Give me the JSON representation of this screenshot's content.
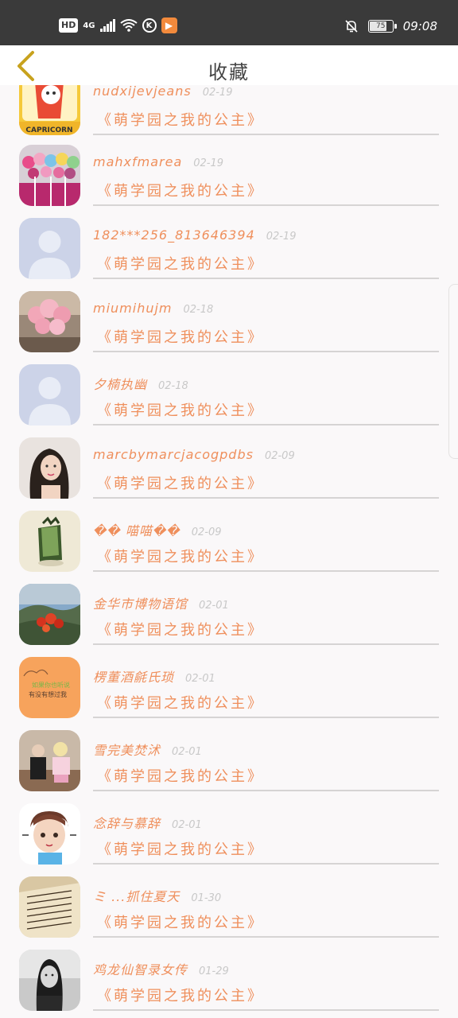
{
  "status_bar": {
    "hd": "HD",
    "network": "4G",
    "time": "09:08",
    "battery": "75"
  },
  "header": {
    "title": "收藏",
    "back_icon": "chevron-left-icon"
  },
  "colors": {
    "accent": "#ef8f5c",
    "back_arrow": "#c8a21e",
    "status_bg": "#3a3a3a"
  },
  "favorites": [
    {
      "name": "nudxijevjeans",
      "date": "02-19",
      "book": "《萌学园之我的公主》"
    },
    {
      "name": "mahxfmarea",
      "date": "02-19",
      "book": "《萌学园之我的公主》"
    },
    {
      "name": "182***256_813646394",
      "date": "02-19",
      "book": "《萌学园之我的公主》"
    },
    {
      "name": "miumihujm",
      "date": "02-18",
      "book": "《萌学园之我的公主》"
    },
    {
      "name": "夕楠执幽",
      "date": "02-18",
      "book": "《萌学园之我的公主》"
    },
    {
      "name": "marcbymarcjacogpdbs",
      "date": "02-09",
      "book": "《萌学园之我的公主》"
    },
    {
      "name": "�� 喵喵��",
      "date": "02-09",
      "book": "《萌学园之我的公主》"
    },
    {
      "name": "金华市博物语馆",
      "date": "02-01",
      "book": "《萌学园之我的公主》"
    },
    {
      "name": "楞董酒毹氏琐",
      "date": "02-01",
      "book": "《萌学园之我的公主》"
    },
    {
      "name": "雪完美焚沭",
      "date": "02-01",
      "book": "《萌学园之我的公主》"
    },
    {
      "name": "念辞与慕辞",
      "date": "02-01",
      "book": "《萌学园之我的公主》"
    },
    {
      "name": "ミ ...抓住夏天",
      "date": "01-30",
      "book": "《萌学园之我的公主》"
    },
    {
      "name": "鸡龙仙智录女传",
      "date": "01-29",
      "book": "《萌学园之我的公主》"
    }
  ],
  "avatar_texts": {
    "capricorn": "CAPRICORN",
    "orange_line1": "如果你也听说",
    "orange_line2": "有没有想过我"
  }
}
